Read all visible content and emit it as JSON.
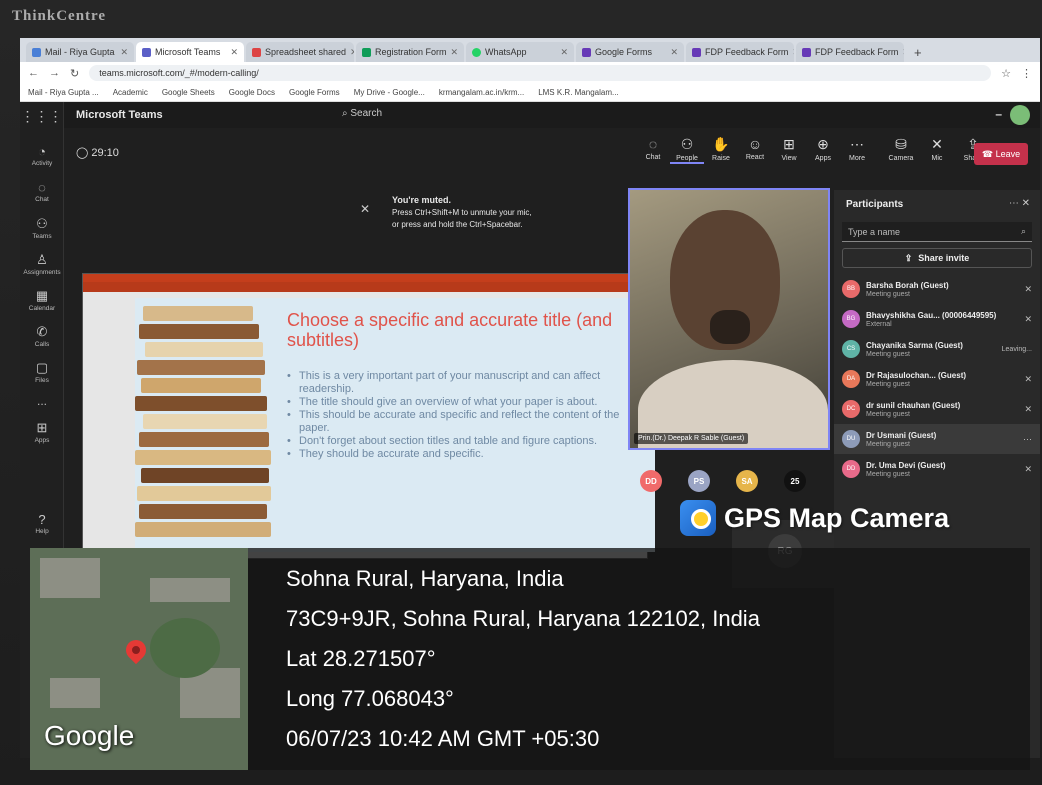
{
  "monitor_brand": "ThinkCentre",
  "browser": {
    "tabs": [
      {
        "label": "Mail - Riya Gupta"
      },
      {
        "label": "Microsoft Teams"
      },
      {
        "label": "Spreadsheet shared"
      },
      {
        "label": "Registration Form"
      },
      {
        "label": "WhatsApp"
      },
      {
        "label": "Google Forms"
      },
      {
        "label": "FDP Feedback Form"
      },
      {
        "label": "FDP Feedback Form"
      }
    ],
    "url": "teams.microsoft.com/_#/modern-calling/",
    "bookmarks": [
      "Mail - Riya Gupta ...",
      "Academic",
      "Google Sheets",
      "Google Docs",
      "Google Forms",
      "My Drive - Google...",
      "krmangalam.ac.in/krm...",
      "LMS K.R. Mangalam..."
    ]
  },
  "teams": {
    "app_title": "Microsoft Teams",
    "search_placeholder": "Search",
    "rail": [
      "Activity",
      "Chat",
      "Teams",
      "Assignments",
      "Calendar",
      "Calls",
      "Files",
      "...",
      "Apps",
      "Help"
    ],
    "timer": "29:10",
    "controls": [
      "Chat",
      "People",
      "Raise",
      "React",
      "View",
      "Apps",
      "More",
      "Camera",
      "Mic",
      "Share"
    ],
    "leave_label": "Leave",
    "muted_title": "You're muted.",
    "muted_line1": "Press Ctrl+Shift+M to unmute your mic,",
    "muted_line2": "or press and hold the Ctrl+Spacebar.",
    "speaker_label": "Prin.(Dr.) Deepak R Sable (Guest)",
    "small_avatars": [
      {
        "initials": "DD",
        "color": "#f06a6a"
      },
      {
        "initials": "PS",
        "color": "#9aa4c4"
      },
      {
        "initials": "SA",
        "color": "#e6b54a"
      },
      {
        "initials": "25",
        "color": "#111111"
      }
    ],
    "rg_initials": "RG"
  },
  "slide": {
    "title": "Choose a specific and accurate title (and subtitles)",
    "bullets": [
      "This is a very important part of your manuscript and can affect readership.",
      "The title should give an overview of what your paper is about.",
      "This should be accurate and specific and reflect the content of the paper.",
      "Don't forget about section titles and table and figure captions.",
      "They should be accurate and specific."
    ]
  },
  "participants": {
    "heading": "Participants",
    "search_placeholder": "Type a name",
    "share_invite": "Share invite",
    "list": [
      {
        "initials": "BB",
        "name": "Barsha Borah (Guest)",
        "sub": "Meeting guest",
        "color": "#e86a6a"
      },
      {
        "initials": "BG",
        "name": "Bhavyshikha Gau... (00006449595)",
        "sub": "External",
        "color": "#c46ac4"
      },
      {
        "initials": "CS",
        "name": "Chayanika Sarma (Guest)",
        "sub": "Meeting guest",
        "color": "#5fb3a6",
        "status": "Leaving..."
      },
      {
        "initials": "DA",
        "name": "Dr Rajasulochan... (Guest)",
        "sub": "Meeting guest",
        "color": "#e8785a"
      },
      {
        "initials": "DC",
        "name": "dr sunil chauhan (Guest)",
        "sub": "Meeting guest",
        "color": "#e86a6a"
      },
      {
        "initials": "DU",
        "name": "Dr Usmani (Guest)",
        "sub": "Meeting guest",
        "color": "#8d9bb8"
      },
      {
        "initials": "DD",
        "name": "Dr. Uma Devi (Guest)",
        "sub": "Meeting guest",
        "color": "#e86a8a"
      }
    ]
  },
  "gps": {
    "brand": "GPS Map Camera",
    "place": "Sohna Rural, Haryana, India",
    "address": "73C9+9JR, Sohna Rural, Haryana 122102, India",
    "lat": "Lat 28.271507°",
    "long": "Long 77.068043°",
    "datetime": "06/07/23 10:42 AM GMT +05:30",
    "map_label": "Google"
  }
}
